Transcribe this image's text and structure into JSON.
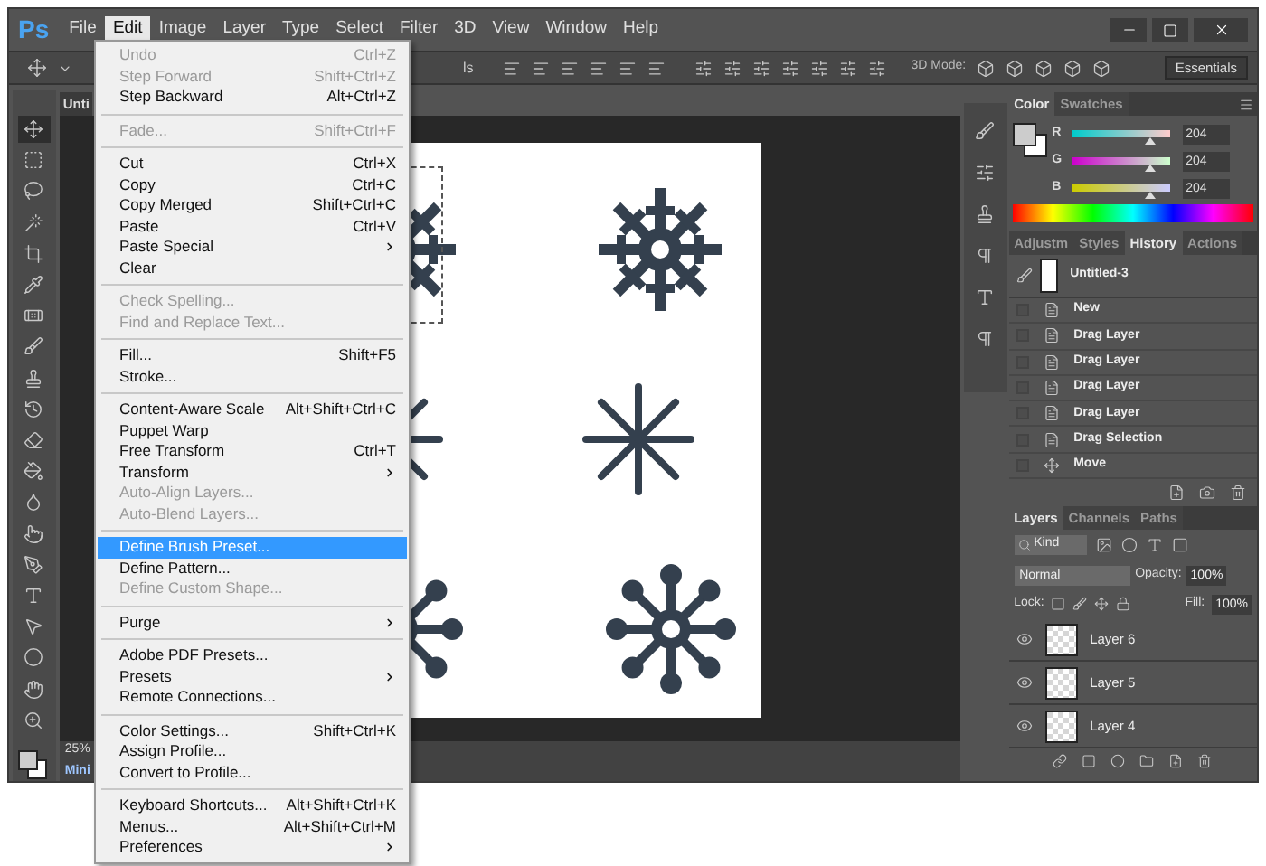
{
  "logo": "Ps",
  "menus": [
    {
      "label": "File",
      "selected": false
    },
    {
      "label": "Edit",
      "selected": true
    },
    {
      "label": "Image",
      "selected": false
    },
    {
      "label": "Layer",
      "selected": false
    },
    {
      "label": "Type",
      "selected": false
    },
    {
      "label": "Select",
      "selected": false
    },
    {
      "label": "Filter",
      "selected": false
    },
    {
      "label": "3D",
      "selected": false
    },
    {
      "label": "View",
      "selected": false
    },
    {
      "label": "Window",
      "selected": false
    },
    {
      "label": "Help",
      "selected": false
    }
  ],
  "options_bar": {
    "label_tail": "ls",
    "mode_label": "3D Mode:",
    "workspace": "Essentials"
  },
  "document_tab": "Unti",
  "status": {
    "zoom": "25%",
    "mini": "Mini"
  },
  "tools": [
    {
      "kind": "move",
      "selected": true
    },
    {
      "kind": "marquee",
      "selected": false
    },
    {
      "kind": "lasso",
      "selected": false
    },
    {
      "kind": "wand",
      "selected": false
    },
    {
      "kind": "crop",
      "selected": false
    },
    {
      "kind": "eyedropper",
      "selected": false
    },
    {
      "kind": "heal",
      "selected": false
    },
    {
      "kind": "brush",
      "selected": false
    },
    {
      "kind": "stamp",
      "selected": false
    },
    {
      "kind": "history",
      "selected": false
    },
    {
      "kind": "eraser",
      "selected": false
    },
    {
      "kind": "bucket",
      "selected": false
    },
    {
      "kind": "blur",
      "selected": false
    },
    {
      "kind": "dodge",
      "selected": false
    },
    {
      "kind": "pen",
      "selected": false
    },
    {
      "kind": "type",
      "selected": false
    },
    {
      "kind": "path",
      "selected": false
    },
    {
      "kind": "ellipse",
      "selected": false
    },
    {
      "kind": "hand",
      "selected": false
    },
    {
      "kind": "zoom",
      "selected": false
    }
  ],
  "edit_menu": [
    [
      {
        "label": "Undo",
        "shortcut": "Ctrl+Z",
        "disabled": true,
        "submenu": false,
        "selected": false
      },
      {
        "label": "Step Forward",
        "shortcut": "Shift+Ctrl+Z",
        "disabled": true,
        "submenu": false,
        "selected": false
      },
      {
        "label": "Step Backward",
        "shortcut": "Alt+Ctrl+Z",
        "disabled": false,
        "submenu": false,
        "selected": false
      }
    ],
    [
      {
        "label": "Fade...",
        "shortcut": "Shift+Ctrl+F",
        "disabled": true,
        "submenu": false,
        "selected": false
      }
    ],
    [
      {
        "label": "Cut",
        "shortcut": "Ctrl+X",
        "disabled": false,
        "submenu": false,
        "selected": false
      },
      {
        "label": "Copy",
        "shortcut": "Ctrl+C",
        "disabled": false,
        "submenu": false,
        "selected": false
      },
      {
        "label": "Copy Merged",
        "shortcut": "Shift+Ctrl+C",
        "disabled": false,
        "submenu": false,
        "selected": false
      },
      {
        "label": "Paste",
        "shortcut": "Ctrl+V",
        "disabled": false,
        "submenu": false,
        "selected": false
      },
      {
        "label": "Paste Special",
        "disabled": false,
        "submenu": true,
        "selected": false
      },
      {
        "label": "Clear",
        "disabled": false,
        "submenu": false,
        "selected": false
      }
    ],
    [
      {
        "label": "Check Spelling...",
        "disabled": true,
        "submenu": false,
        "selected": false
      },
      {
        "label": "Find and Replace Text...",
        "disabled": true,
        "submenu": false,
        "selected": false
      }
    ],
    [
      {
        "label": "Fill...",
        "shortcut": "Shift+F5",
        "disabled": false,
        "submenu": false,
        "selected": false
      },
      {
        "label": "Stroke...",
        "disabled": false,
        "submenu": false,
        "selected": false
      }
    ],
    [
      {
        "label": "Content-Aware Scale",
        "shortcut": "Alt+Shift+Ctrl+C",
        "disabled": false,
        "submenu": false,
        "selected": false
      },
      {
        "label": "Puppet Warp",
        "disabled": false,
        "submenu": false,
        "selected": false
      },
      {
        "label": "Free Transform",
        "shortcut": "Ctrl+T",
        "disabled": false,
        "submenu": false,
        "selected": false
      },
      {
        "label": "Transform",
        "disabled": false,
        "submenu": true,
        "selected": false
      },
      {
        "label": "Auto-Align Layers...",
        "disabled": true,
        "submenu": false,
        "selected": false
      },
      {
        "label": "Auto-Blend Layers...",
        "disabled": true,
        "submenu": false,
        "selected": false
      }
    ],
    [
      {
        "label": "Define Brush Preset...",
        "disabled": false,
        "submenu": false,
        "selected": true
      },
      {
        "label": "Define Pattern...",
        "disabled": false,
        "submenu": false,
        "selected": false
      },
      {
        "label": "Define Custom Shape...",
        "disabled": true,
        "submenu": false,
        "selected": false
      }
    ],
    [
      {
        "label": "Purge",
        "disabled": false,
        "submenu": true,
        "selected": false
      }
    ],
    [
      {
        "label": "Adobe PDF Presets...",
        "disabled": false,
        "submenu": false,
        "selected": false
      },
      {
        "label": "Presets",
        "disabled": false,
        "submenu": true,
        "selected": false
      },
      {
        "label": "Remote Connections...",
        "disabled": false,
        "submenu": false,
        "selected": false
      }
    ],
    [
      {
        "label": "Color Settings...",
        "shortcut": "Shift+Ctrl+K",
        "disabled": false,
        "submenu": false,
        "selected": false
      },
      {
        "label": "Assign Profile...",
        "disabled": false,
        "submenu": false,
        "selected": false
      },
      {
        "label": "Convert to Profile...",
        "disabled": false,
        "submenu": false,
        "selected": false
      }
    ],
    [
      {
        "label": "Keyboard Shortcuts...",
        "shortcut": "Alt+Shift+Ctrl+K",
        "disabled": false,
        "submenu": false,
        "selected": false
      },
      {
        "label": "Menus...",
        "shortcut": "Alt+Shift+Ctrl+M",
        "disabled": false,
        "submenu": false,
        "selected": false
      },
      {
        "label": "Preferences",
        "disabled": false,
        "submenu": true,
        "selected": false
      }
    ]
  ],
  "color_panel": {
    "tabs": [
      {
        "label": "Color",
        "selected": true
      },
      {
        "label": "Swatches",
        "selected": false
      }
    ],
    "channels": [
      {
        "name": "R",
        "value": "204",
        "level": 0.8
      },
      {
        "name": "G",
        "value": "204",
        "level": 0.8
      },
      {
        "name": "B",
        "value": "204",
        "level": 0.8
      }
    ]
  },
  "history_panel": {
    "tabs": [
      {
        "label": "Adjustm",
        "selected": false
      },
      {
        "label": "Styles",
        "selected": false
      },
      {
        "label": "History",
        "selected": true
      },
      {
        "label": "Actions",
        "selected": false
      }
    ],
    "snapshot": "Untitled-3",
    "items": [
      {
        "label": "New",
        "kind": "doc",
        "selected": false
      },
      {
        "label": "Drag Layer",
        "kind": "doc",
        "selected": false
      },
      {
        "label": "Drag Layer",
        "kind": "doc",
        "selected": false
      },
      {
        "label": "Drag Layer",
        "kind": "doc",
        "selected": false
      },
      {
        "label": "Drag Layer",
        "kind": "doc",
        "selected": false
      },
      {
        "label": "Drag Selection",
        "kind": "doc",
        "selected": false
      },
      {
        "label": "Move",
        "kind": "move",
        "selected": false
      }
    ]
  },
  "layers_panel": {
    "tabs": [
      {
        "label": "Layers",
        "selected": true
      },
      {
        "label": "Channels",
        "selected": false
      },
      {
        "label": "Paths",
        "selected": false
      }
    ],
    "filter": "Kind",
    "blend": "Normal",
    "opacity_label": "Opacity:",
    "opacity": "100%",
    "lock_label": "Lock:",
    "fill_label": "Fill:",
    "fill": "100%",
    "layers": [
      {
        "name": "Layer 6",
        "visible": true
      },
      {
        "name": "Layer 5",
        "visible": true
      },
      {
        "name": "Layer 4",
        "visible": true
      }
    ]
  }
}
